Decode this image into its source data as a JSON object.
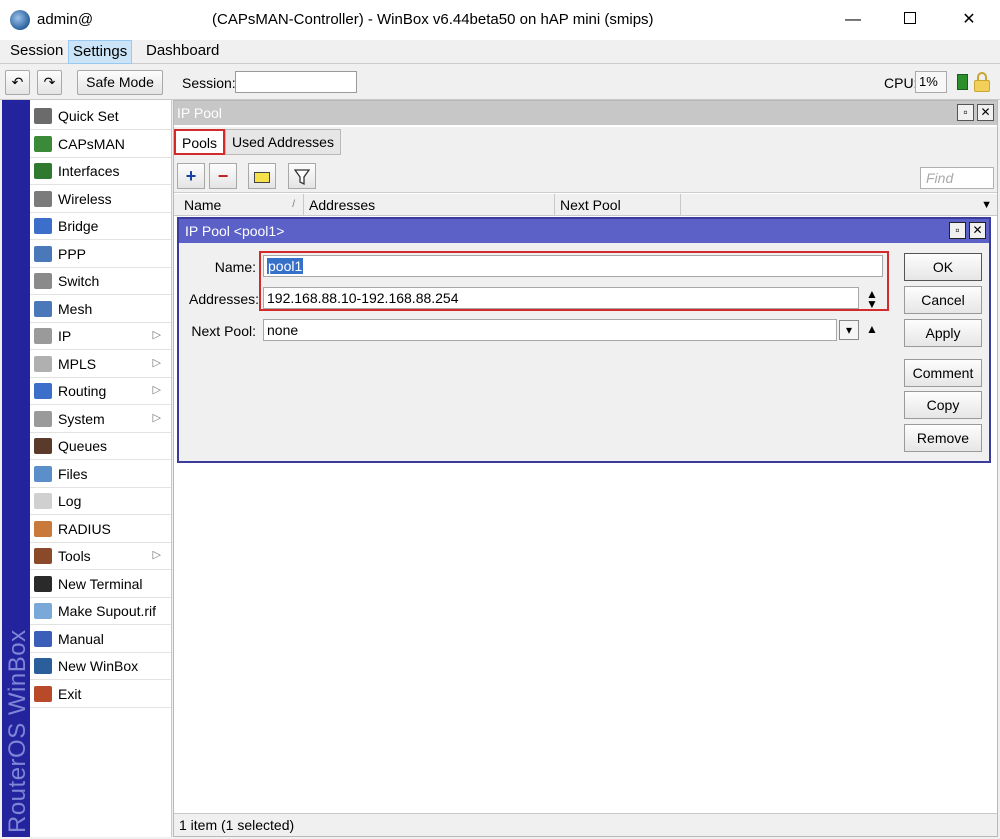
{
  "window": {
    "user": "admin@",
    "title": "(CAPsMAN-Controller) - WinBox v6.44beta50 on hAP mini (smips)",
    "minimize": "—",
    "close": "✕"
  },
  "menu": [
    "Session",
    "Settings",
    "Dashboard"
  ],
  "toolbar": {
    "undo": "↶",
    "redo": "↷",
    "safe_mode": "Safe Mode",
    "session_label": "Session:",
    "session_value": "",
    "cpu_label": "CPU:",
    "cpu_value": "1%"
  },
  "brand": "RouterOS WinBox",
  "sidebar": {
    "items": [
      {
        "label": "Quick Set",
        "icon": "quick-set-icon",
        "color": "#6b6b6b",
        "submenu": ""
      },
      {
        "label": "CAPsMAN",
        "icon": "capsman-icon",
        "color": "#3a8a3a",
        "submenu": ""
      },
      {
        "label": "Interfaces",
        "icon": "interfaces-icon",
        "color": "#2f7a2f",
        "submenu": ""
      },
      {
        "label": "Wireless",
        "icon": "wireless-icon",
        "color": "#7b7b7b",
        "submenu": ""
      },
      {
        "label": "Bridge",
        "icon": "bridge-icon",
        "color": "#3b6fc9",
        "submenu": ""
      },
      {
        "label": "PPP",
        "icon": "ppp-icon",
        "color": "#4a78b8",
        "submenu": ""
      },
      {
        "label": "Switch",
        "icon": "switch-icon",
        "color": "#8a8a8a",
        "submenu": ""
      },
      {
        "label": "Mesh",
        "icon": "mesh-icon",
        "color": "#4a78b8",
        "submenu": ""
      },
      {
        "label": "IP",
        "icon": "ip-icon",
        "color": "#9a9a9a",
        "submenu": "▷"
      },
      {
        "label": "MPLS",
        "icon": "mpls-icon",
        "color": "#b0b0b0",
        "submenu": "▷"
      },
      {
        "label": "Routing",
        "icon": "routing-icon",
        "color": "#3b6fc9",
        "submenu": "▷"
      },
      {
        "label": "System",
        "icon": "system-icon",
        "color": "#9a9a9a",
        "submenu": "▷"
      },
      {
        "label": "Queues",
        "icon": "queues-icon",
        "color": "#5a3a2a",
        "submenu": ""
      },
      {
        "label": "Files",
        "icon": "files-icon",
        "color": "#5b8fc9",
        "submenu": ""
      },
      {
        "label": "Log",
        "icon": "log-icon",
        "color": "#d0d0d0",
        "submenu": ""
      },
      {
        "label": "RADIUS",
        "icon": "radius-icon",
        "color": "#c97a3b",
        "submenu": ""
      },
      {
        "label": "Tools",
        "icon": "tools-icon",
        "color": "#8a4a2a",
        "submenu": "▷"
      },
      {
        "label": "New Terminal",
        "icon": "terminal-icon",
        "color": "#2a2a2a",
        "submenu": ""
      },
      {
        "label": "Make Supout.rif",
        "icon": "supout-icon",
        "color": "#7aa8d8",
        "submenu": ""
      },
      {
        "label": "Manual",
        "icon": "manual-icon",
        "color": "#3b5fb8",
        "submenu": ""
      },
      {
        "label": "New WinBox",
        "icon": "new-winbox-icon",
        "color": "#2a5f9c",
        "submenu": ""
      },
      {
        "label": "Exit",
        "icon": "exit-icon",
        "color": "#b84a2a",
        "submenu": ""
      }
    ]
  },
  "panel": {
    "title": "IP Pool",
    "restore": "▫",
    "close": "✕",
    "tabs": [
      "Pools",
      "Used Addresses"
    ],
    "add": "+",
    "remove": "−",
    "find_placeholder": "Find",
    "columns": [
      "Name",
      "Addresses",
      "Next Pool"
    ],
    "sort_indicator": "/",
    "column_menu": "▼",
    "status": "1 item (1 selected)"
  },
  "dialog": {
    "title": "IP Pool <pool1>",
    "name_label": "Name:",
    "name_value": "pool1",
    "addresses_label": "Addresses:",
    "addresses_value": "192.168.88.10-192.168.88.254",
    "next_pool_label": "Next Pool:",
    "next_pool_value": "none",
    "buttons": {
      "ok": "OK",
      "cancel": "Cancel",
      "apply": "Apply",
      "comment": "Comment",
      "copy": "Copy",
      "remove": "Remove"
    }
  },
  "colors": {
    "brand_strip": "#23239d",
    "dialog_title": "#5b61c7",
    "highlight": "#d32b2b",
    "cpu_bar": "#2c8f2c"
  }
}
